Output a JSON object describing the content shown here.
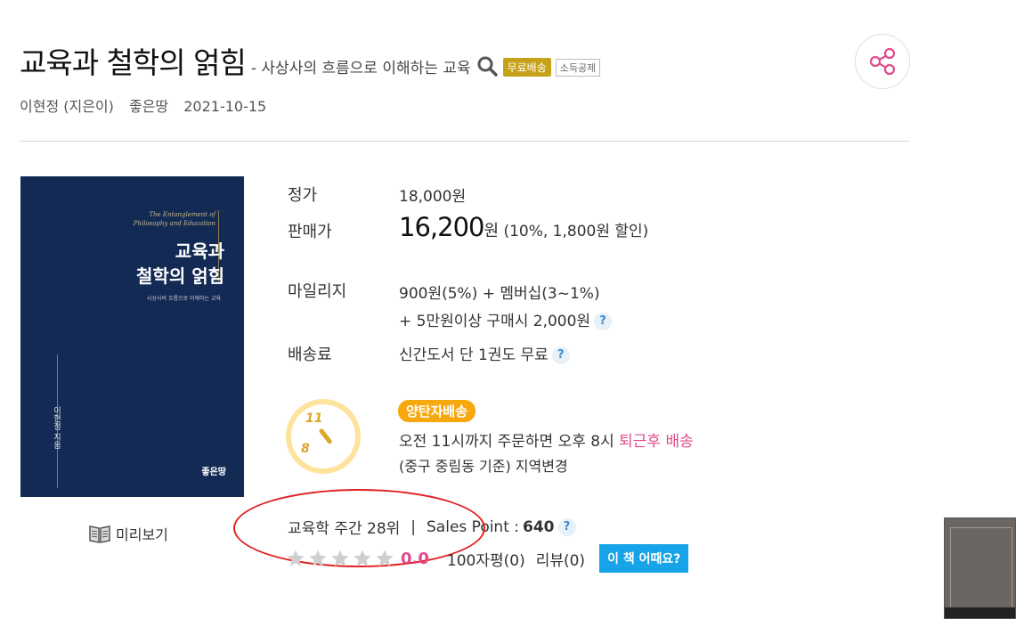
{
  "header": {
    "title": "교육과 철학의 얽힘",
    "subtitle": "- 사상사의 흐름으로 이해하는 교육",
    "badge_free": "무료배송",
    "badge_tax": "소득공제"
  },
  "meta": {
    "author": "이현정 (지은이)",
    "publisher": "좋은땅",
    "date": "2021-10-15"
  },
  "cover": {
    "en_title_1": "The Entanglement of",
    "en_title_2": "Philosophy and Education",
    "ko_title_1": "교육과",
    "ko_title_2": "철학의 얽힘",
    "subtitle": "사상사의 흐름으로 이해하는 교육",
    "author": "이현정 지음",
    "publisher": "좋은땅",
    "bg_color": "#132a55"
  },
  "preview": {
    "label": "미리보기"
  },
  "price": {
    "list_label": "정가",
    "list_value": "18,000원",
    "sale_label": "판매가",
    "sale_value": "16,200",
    "sale_unit": "원",
    "discount": " (10%, 1,800원 할인)"
  },
  "mileage": {
    "label": "마일리지",
    "line1": "900원(5%) + 멤버십(3~1%)",
    "line2": "+ 5만원이상 구매시 2,000원"
  },
  "shipping": {
    "label": "배송료",
    "value": "신간도서 단 1권도 무료"
  },
  "delivery": {
    "badge": "양탄자배송",
    "clock_11": "11",
    "clock_8": "8",
    "line1_prefix": "오전 11시까지 주문하면 오후 8시 ",
    "line1_highlight": "퇴근후 배송",
    "line2": "(중구 중림동 기준) 지역변경"
  },
  "ranking": {
    "rank_text": "교육학 주간 28위",
    "separator": "|",
    "sales_label": "Sales Point :",
    "sales_value": "640"
  },
  "rating": {
    "score": "0.0",
    "stars_filled": 0,
    "short_reviews": "100자평(0)",
    "reviews": "리뷰(0)",
    "opinion_button": "이 책 어때요?"
  },
  "help_icon": "?",
  "colors": {
    "accent_pink": "#e04b8c",
    "badge_orange": "#f8a80f",
    "badge_gold": "#c6a11a",
    "button_blue": "#16a3e8",
    "annotation_red": "#e02020"
  }
}
